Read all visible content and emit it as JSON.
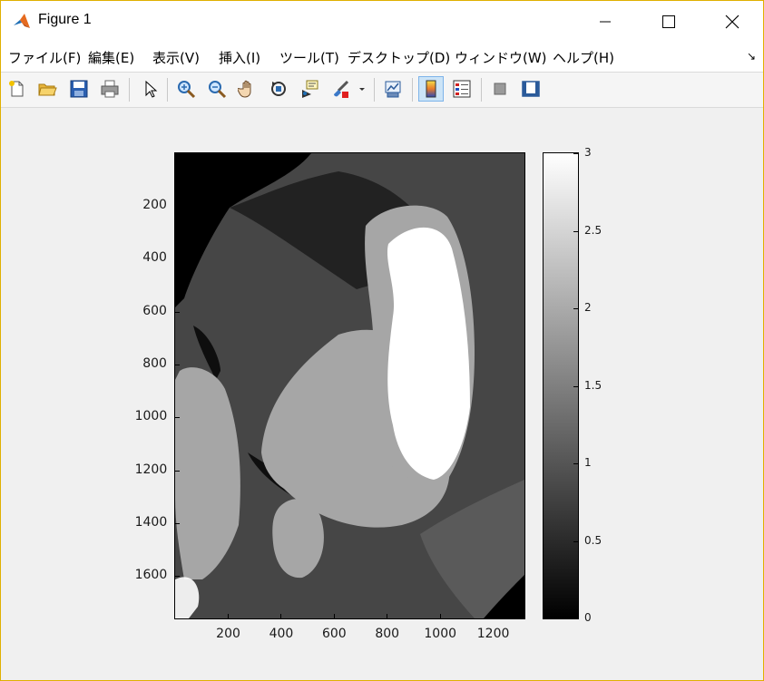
{
  "window": {
    "title": "Figure 1",
    "icons": {
      "app": "matlab-logo-icon",
      "minimize": "minimize-icon",
      "maximize": "maximize-icon",
      "close": "close-icon"
    }
  },
  "menu": {
    "items": [
      "ファイル(F)",
      "編集(E)",
      "表示(V)",
      "挿入(I)",
      "ツール(T)",
      "デスクトップ(D)",
      "ウィンドウ(W)",
      "ヘルプ(H)"
    ],
    "dock_glyph": "↘"
  },
  "toolbar": {
    "buttons": [
      "new-figure",
      "open-file",
      "save",
      "print",
      "edit-plot",
      "zoom-in",
      "zoom-out",
      "pan",
      "rotate-3d",
      "data-cursor",
      "brush",
      "brush-dropdown",
      "link-plot",
      "insert-colorbar",
      "insert-legend",
      "hide-plot-tools",
      "show-plot-tools"
    ],
    "active": "insert-colorbar"
  },
  "chart_data": {
    "type": "heatmap",
    "colormap": "gray",
    "x_ticks": [
      "200",
      "400",
      "600",
      "800",
      "1000",
      "1200"
    ],
    "y_ticks": [
      "200",
      "400",
      "600",
      "800",
      "1000",
      "1200",
      "1400",
      "1600"
    ],
    "xlim": [
      1,
      1320
    ],
    "ylim": [
      1,
      1760
    ],
    "colorbar": {
      "ticks": [
        "0",
        "0.5",
        "1",
        "1.5",
        "2",
        "2.5",
        "3"
      ],
      "clim": [
        0,
        3
      ]
    },
    "levels": [
      0,
      1,
      2,
      3
    ]
  }
}
